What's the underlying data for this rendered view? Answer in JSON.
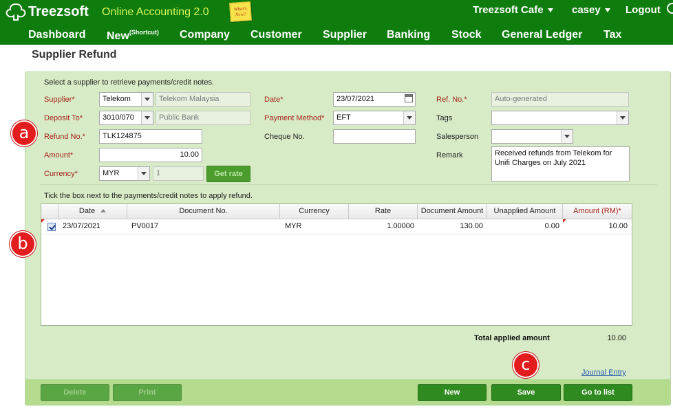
{
  "header": {
    "logo_text": "Treezsoft",
    "app_name": "Online Accounting 2.0",
    "note_badge": "What's New?",
    "company": "Treezsoft Cafe",
    "user": "casey",
    "logout": "Logout"
  },
  "nav": {
    "dashboard": "Dashboard",
    "new": "New",
    "new_sup": "(Shortcut)",
    "company": "Company",
    "customer": "Customer",
    "supplier": "Supplier",
    "banking": "Banking",
    "stock": "Stock",
    "general_ledger": "General Ledger",
    "tax": "Tax"
  },
  "page": {
    "title": "Supplier Refund"
  },
  "form": {
    "instruction": "Select a supplier to retrieve payments/credit notes.",
    "supplier_label": "Supplier*",
    "supplier_code": "Telekom",
    "supplier_name": "Telekom Malaysia",
    "deposit_label": "Deposit To*",
    "deposit_code": "3010/070",
    "deposit_name": "Public Bank",
    "refund_label": "Refund No.*",
    "refund_value": "TLK124875",
    "amount_label": "Amount*",
    "amount_value": "10.00",
    "currency_label": "Currency*",
    "currency_value": "MYR",
    "rate_value": "1",
    "get_rate": "Get rate",
    "date_label": "Date*",
    "date_value": "23/07/2021",
    "payment_method_label": "Payment Method*",
    "payment_method_value": "EFT",
    "cheque_label": "Cheque No.",
    "cheque_value": "",
    "ref_label": "Ref. No.*",
    "ref_value": "Auto-generated",
    "tags_label": "Tags",
    "tags_value": "",
    "salesperson_label": "Salesperson",
    "salesperson_value": "",
    "remark_label": "Remark",
    "remark_value": "Received refunds from Telekom for Unifi Charges on July 2021"
  },
  "grid": {
    "instruction": "Tick the box next to the payments/credit notes to apply refund.",
    "columns": [
      "Date",
      "Document No.",
      "Currency",
      "Rate",
      "Document Amount",
      "Unapplied Amount",
      "Amount (RM)*"
    ],
    "rows": [
      {
        "date": "23/07/2021",
        "doc_no": "PV0017",
        "currency": "MYR",
        "rate": "1.00000",
        "doc_amount": "130.00",
        "unapplied": "0.00",
        "amount": "10.00",
        "checked": true
      }
    ],
    "total_label": "Total applied amount",
    "total_value": "10.00",
    "journal_link": "Journal Entry"
  },
  "footer": {
    "delete": "Delete",
    "print": "Print",
    "new": "New",
    "save": "Save",
    "go_to_list": "Go to list"
  },
  "markers": {
    "a": "a",
    "b": "b",
    "c": "c"
  },
  "colors": {
    "topbar": "#0e7d0e",
    "accent_text": "#d7f85a",
    "panel": "#d6ebc6",
    "required_label": "#a8231c",
    "button": "#2f8a1f",
    "marker": "#e31d1d"
  }
}
